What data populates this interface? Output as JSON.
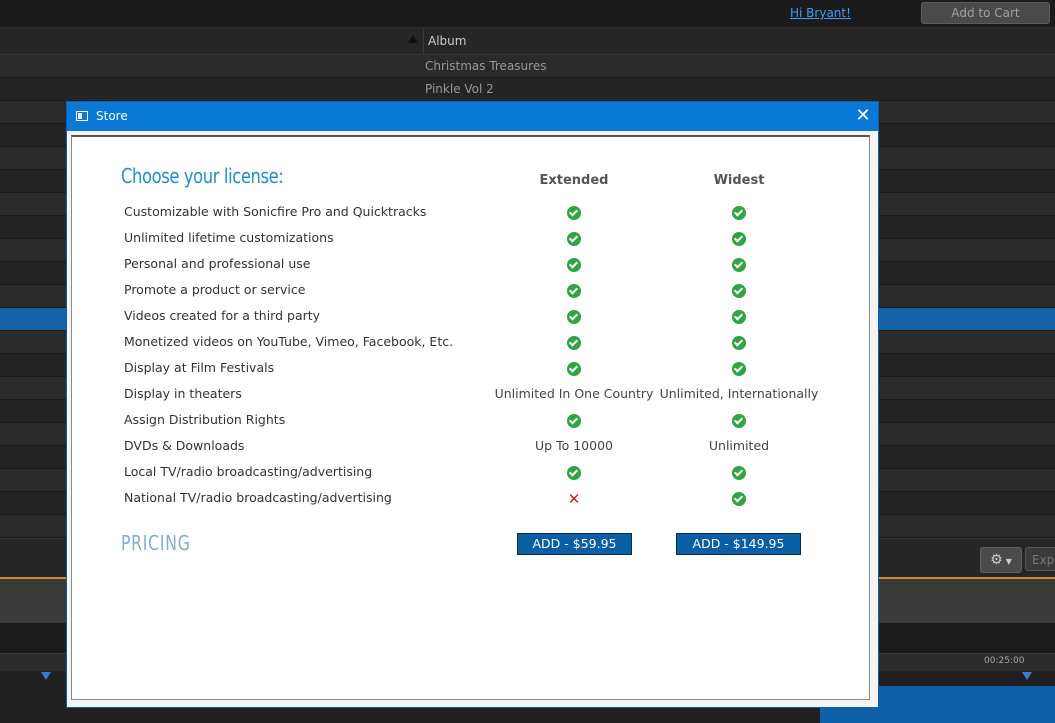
{
  "topbar": {
    "greeting": "Hi Bryant!",
    "add_to_cart": "Add to Cart"
  },
  "list": {
    "column_header": "Album",
    "rows": [
      "Christmas Treasures",
      "Pinkle Vol 2"
    ]
  },
  "timeline": {
    "timecode": "00:25:00"
  },
  "toolbar": {
    "gear_icon": "gear-icon",
    "export_label": "Exp"
  },
  "dialog": {
    "title": "Store",
    "close_glyph": "✕",
    "heading": "Choose your license:",
    "columns": [
      "Extended",
      "Widest"
    ],
    "features": [
      {
        "label": "Customizable with Sonicfire Pro and Quicktracks",
        "extended": "check",
        "widest": "check"
      },
      {
        "label": "Unlimited lifetime customizations",
        "extended": "check",
        "widest": "check"
      },
      {
        "label": "Personal and professional use",
        "extended": "check",
        "widest": "check"
      },
      {
        "label": "Promote a product or service",
        "extended": "check",
        "widest": "check"
      },
      {
        "label": "Videos created for a third party",
        "extended": "check",
        "widest": "check"
      },
      {
        "label": "Monetized videos on YouTube, Vimeo, Facebook, Etc.",
        "extended": "check",
        "widest": "check"
      },
      {
        "label": "Display at Film Festivals",
        "extended": "check",
        "widest": "check"
      },
      {
        "label": "Display in theaters",
        "extended": "Unlimited In One Country",
        "widest": "Unlimited, Internationally"
      },
      {
        "label": "Assign Distribution Rights",
        "extended": "check",
        "widest": "check"
      },
      {
        "label": "DVDs & Downloads",
        "extended": "Up To 10000",
        "widest": "Unlimited"
      },
      {
        "label": "Local TV/radio broadcasting/advertising",
        "extended": "check",
        "widest": "check"
      },
      {
        "label": "National TV/radio broadcasting/advertising",
        "extended": "cross",
        "widest": "check"
      }
    ],
    "pricing_label": "PRICING",
    "buttons": {
      "extended": "ADD - $59.95",
      "widest": "ADD - $149.95"
    }
  },
  "colors": {
    "accent": "#0a78d7",
    "heading": "#1d8fd0",
    "check": "#2ea541",
    "cross": "#c3232d",
    "button": "#0a5ea6",
    "selection": "#1463a8",
    "timeline_orange": "#d58a1c"
  }
}
